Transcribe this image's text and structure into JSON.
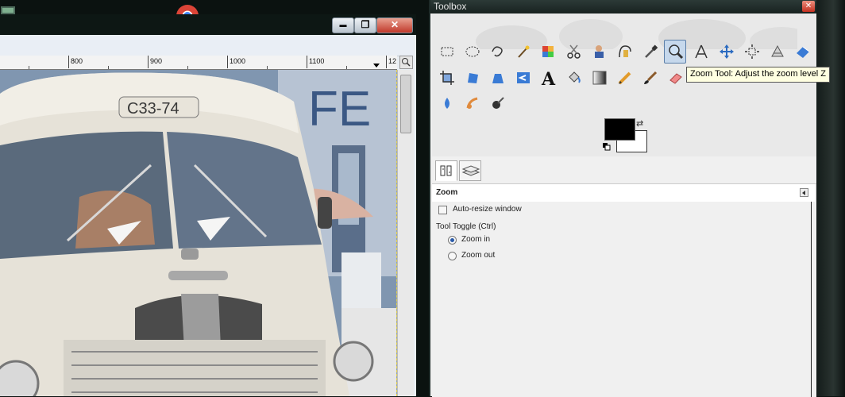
{
  "desktop": {
    "icons": [
      "app-icon",
      "chrome-icon"
    ]
  },
  "image_window": {
    "controls": {
      "minimize": "▬",
      "maximize": "❐",
      "close": "✕"
    },
    "ruler_labels": [
      "800",
      "900",
      "1000",
      "1100",
      "12"
    ],
    "photo_plate_text": "C33-74",
    "photo_sign_text": "FE"
  },
  "toolbox": {
    "title": "Toolbox",
    "close": "✕",
    "tools": [
      "rect-select-icon",
      "ellipse-select-icon",
      "free-select-icon",
      "fuzzy-select-icon",
      "select-by-color-icon",
      "scissors-icon",
      "foreground-select-icon",
      "paths-icon",
      "color-picker-icon",
      "zoom-icon",
      "measure-icon",
      "move-icon",
      "align-icon",
      "transform-icon",
      "crop-icon",
      "rotate-icon",
      "scale-icon",
      "shear-icon",
      "text-icon",
      "bucket-fill-icon",
      "blend-icon",
      "pencil-icon",
      "paintbrush-icon",
      "eraser-icon",
      "dodge-icon",
      "smudge-icon",
      "ink-icon"
    ],
    "selected_tool": "zoom-icon",
    "colors": {
      "foreground": "#000000",
      "background": "#ffffff"
    },
    "tool_options": {
      "header": "Zoom",
      "auto_resize_label": "Auto-resize window",
      "toggle_label": "Tool Toggle  (Ctrl)",
      "zoom_in_label": "Zoom in",
      "zoom_out_label": "Zoom out",
      "zoom_in_selected": true
    },
    "tooltip": "Zoom Tool: Adjust the zoom level  Z"
  }
}
